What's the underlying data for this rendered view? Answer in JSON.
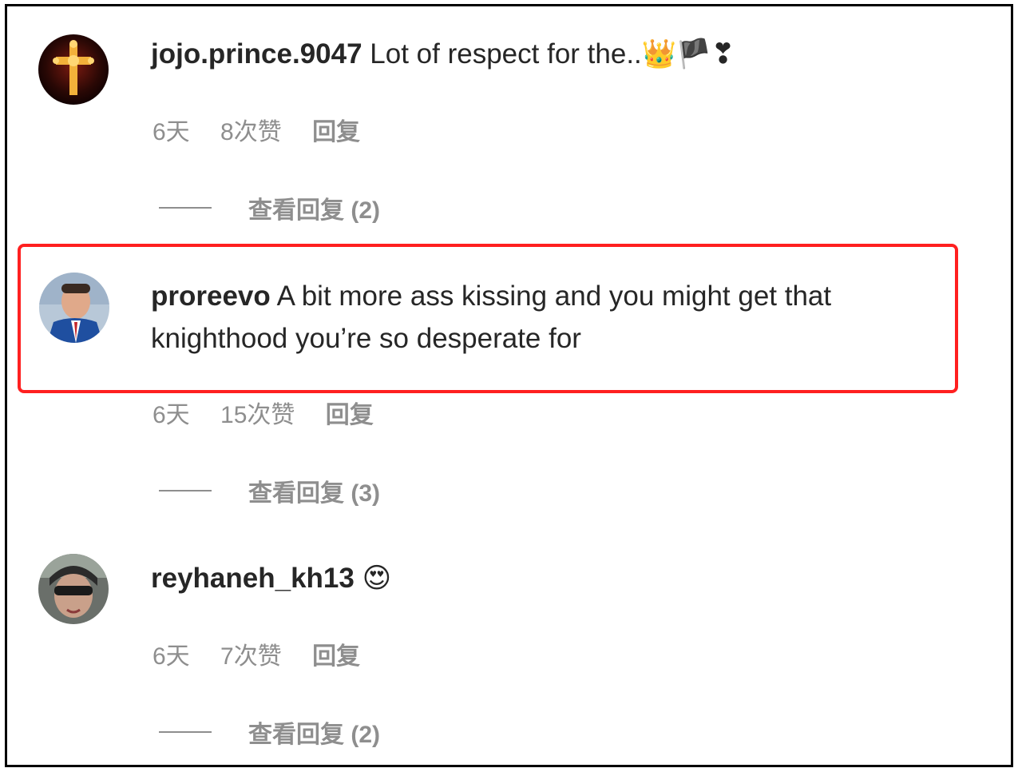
{
  "colors": {
    "username": "#262626",
    "meta": "#8e8e8e",
    "highlight_border": "#ff2020"
  },
  "comments": [
    {
      "username": "jojo.prince.9047",
      "text": "Lot of respect for the..",
      "emojis": "👑🏴❣",
      "time": "6天",
      "likes": "8次赞",
      "reply": "回复",
      "view_replies": "查看回复 (2)"
    },
    {
      "username": "proreevo",
      "text_line1": "A bit more ass kissing and you might get that",
      "text_line2": "knighthood you’re so desperate for",
      "time": "6天",
      "likes": "15次赞",
      "reply": "回复",
      "view_replies": "查看回复 (3)"
    },
    {
      "username": "reyhaneh_kh13",
      "emojis": "😍",
      "time": "6天",
      "likes": "7次赞",
      "reply": "回复",
      "view_replies": "查看回复 (2)"
    }
  ]
}
